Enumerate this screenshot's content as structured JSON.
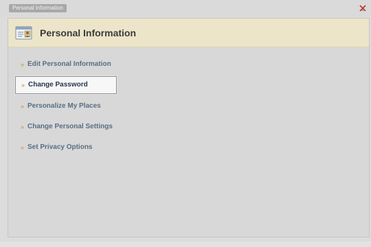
{
  "window": {
    "tab_title": "Personal Information"
  },
  "panel": {
    "title": "Personal Information"
  },
  "menu": {
    "items": [
      {
        "label": "Edit Personal Information",
        "selected": false
      },
      {
        "label": "Change Password",
        "selected": true
      },
      {
        "label": "Personalize My Places",
        "selected": false
      },
      {
        "label": "Change Personal Settings",
        "selected": false
      },
      {
        "label": "Set Privacy Options",
        "selected": false
      }
    ],
    "arrow_glyph": "»"
  },
  "colors": {
    "header_bg": "#ece5c9",
    "link": "#5a6e80",
    "arrow": "#c9a84c",
    "close": "#c0392b"
  },
  "icons": {
    "header": "id-card-icon",
    "close": "close-icon"
  }
}
